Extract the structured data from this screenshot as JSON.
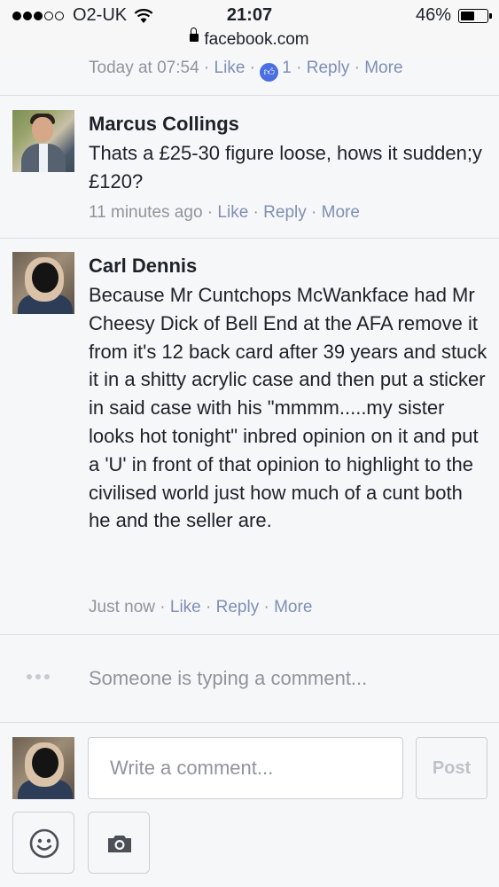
{
  "status_bar": {
    "carrier": "O2-UK",
    "time": "21:07",
    "battery": "46%"
  },
  "address_bar": {
    "url": "facebook.com"
  },
  "previous_comment": {
    "time": "Today at 07:54",
    "like": "Like",
    "reaction_count": "1",
    "reply": "Reply",
    "more": "More"
  },
  "comments": [
    {
      "author": "Marcus Collings",
      "text": "Thats a £25-30 figure loose, hows it sudden;y £120?",
      "time": "11 minutes ago",
      "like": "Like",
      "reply": "Reply",
      "more": "More"
    },
    {
      "author": "Carl Dennis",
      "text": "Because Mr Cuntchops McWankface had Mr Cheesy Dick of Bell End at the AFA remove it from it's 12 back card after 39 years and stuck it in a shitty acrylic case and then put a sticker in said case with his \"mmmm.....my sister looks hot tonight\" inbred opinion on it and put a 'U' in front of that opinion to highlight to the civilised world just how much of a cunt both he and the seller are.",
      "time": "Just now",
      "like": "Like",
      "reply": "Reply",
      "more": "More"
    }
  ],
  "typing_indicator": "Someone is typing a comment...",
  "composer": {
    "placeholder": "Write a comment...",
    "post_label": "Post"
  },
  "colors": {
    "link": "#7f8fb3",
    "meta": "#90949c",
    "like_badge": "#4a6fe0",
    "background": "#f6f7f9"
  }
}
